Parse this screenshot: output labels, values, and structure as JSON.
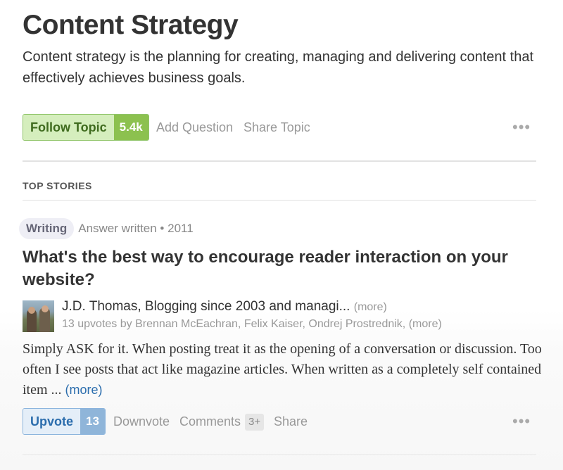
{
  "topic": {
    "title": "Content Strategy",
    "description": "Content strategy is the planning for creating, managing and delivering content that effectively achieves business goals.",
    "follow_label": "Follow Topic",
    "follower_count": "5.4k",
    "add_question": "Add Question",
    "share_topic": "Share Topic",
    "more_glyph": "•••"
  },
  "section": {
    "heading": "TOP STORIES"
  },
  "story": {
    "topic_tag": "Writing",
    "meta": "Answer written • 2011",
    "title": "What's the best way to encourage reader interaction on your website?",
    "author": {
      "line": "J.D. Thomas, Blogging since 2003 and managi...",
      "more": "(more)",
      "upvoters_text": "13 upvotes by Brennan McEachran, Felix Kaiser, Ondrej Prostrednik,",
      "upvoters_more": "(more)"
    },
    "body": "Simply ASK for it.  When posting treat it as the opening of a conversation or discussion.   Too often I see posts that act like magazine articles.  When written as a completely self contained item ...",
    "body_more": "(more)",
    "actions": {
      "upvote_label": "Upvote",
      "upvote_count": "13",
      "downvote_label": "Downvote",
      "comments_label": "Comments",
      "comments_count": "3+",
      "share_label": "Share",
      "more_glyph": "•••"
    }
  },
  "colors": {
    "follow_green": "#8cc14f",
    "upvote_blue": "#8fb5d9",
    "link_blue": "#2b6dad",
    "text_dark": "#333333",
    "text_muted": "#999999"
  }
}
